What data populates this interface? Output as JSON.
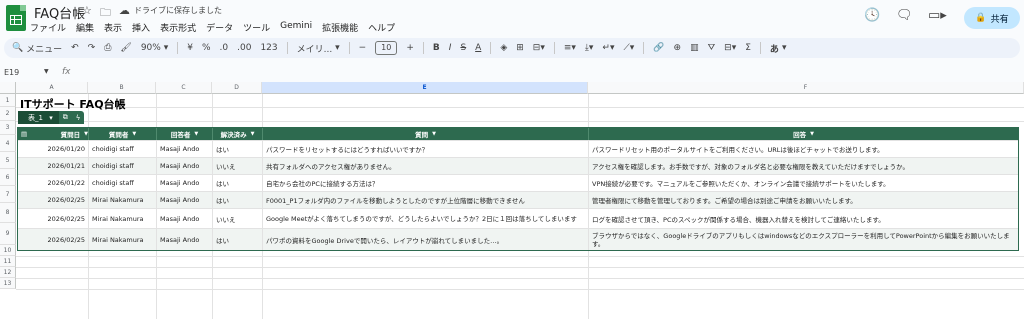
{
  "app": {
    "title": "FAQ台帳",
    "save_status": "ドライブに保存しました",
    "menu": [
      "ファイル",
      "編集",
      "表示",
      "挿入",
      "表示形式",
      "データ",
      "ツール",
      "Gemini",
      "拡張機能",
      "ヘルプ"
    ],
    "share_label": "共有"
  },
  "toolbar": {
    "menus_label": "メニュー",
    "zoom": "90%",
    "currency": "¥",
    "percent": "%",
    "dec_decrease": ".0",
    "dec_increase": ".00",
    "number_format": "123",
    "font": "メイリ...",
    "font_size": "10",
    "input_tools": "あ"
  },
  "formula_bar": {
    "cell_ref": "E19",
    "fx": "fx"
  },
  "columns": [
    "A",
    "B",
    "C",
    "D",
    "E",
    "F"
  ],
  "rows": [
    "1",
    "2",
    "3",
    "4",
    "5",
    "6",
    "7",
    "8",
    "9",
    "10",
    "11",
    "12",
    "13"
  ],
  "sheet_title": "ITサポート FAQ台帳",
  "table": {
    "name": "表_1",
    "headers": [
      "質問日",
      "質問者",
      "回答者",
      "解決済み",
      "質問",
      "回答"
    ],
    "rows": [
      [
        "2026/01/20",
        "choidigi staff",
        "Masaji Ando",
        "はい",
        "パスワードをリセットするにはどうすればいいですか？",
        "パスワードリセット用のポータルサイトをご利用ください。URLは後ほどチャットでお送りします。"
      ],
      [
        "2026/01/21",
        "choidigi staff",
        "Masaji Ando",
        "いいえ",
        "共有フォルダへのアクセス権がありません。",
        "アクセス権を確認します。お手数ですが、対象のフォルダ名と必要な権限を教えていただけますでしょうか。"
      ],
      [
        "2026/01/22",
        "choidigi staff",
        "Masaji Ando",
        "はい",
        "自宅から会社のPCに接続する方法は？",
        "VPN接続が必要です。マニュアルをご参照いただくか、オンライン会議で接続サポートをいたします。"
      ],
      [
        "2026/02/25",
        "Mirai Nakamura",
        "Masaji Ando",
        "はい",
        "F0001_P1フォルダ内のファイルを移動しようとしたのですが上位階層に移動できません",
        "管理者権限にて移動を管理しております。ご希望の場合は別途ご申請をお願いいたします。"
      ],
      [
        "2026/02/25",
        "Mirai Nakamura",
        "Masaji Ando",
        "いいえ",
        "Google Meetがよく落ちてしまうのですが、どうしたらよいでしょうか？2日に１回は落ちしてしまいます",
        "ログを確認させて頂き、PCのスペックが関係する場合、機器入れ替えを検討してご連絡いたします。"
      ],
      [
        "2026/02/25",
        "Mirai Nakamura",
        "Masaji Ando",
        "はい",
        "パワポの資料をGoogle Driveで開いたら、レイアウトが崩れてしまいました…。",
        "ブラウザからではなく、Googleドライブのアプリもしくはwindowsなどのエクスプローラーを利用してPowerPointから編集をお願いいたします。"
      ]
    ]
  }
}
